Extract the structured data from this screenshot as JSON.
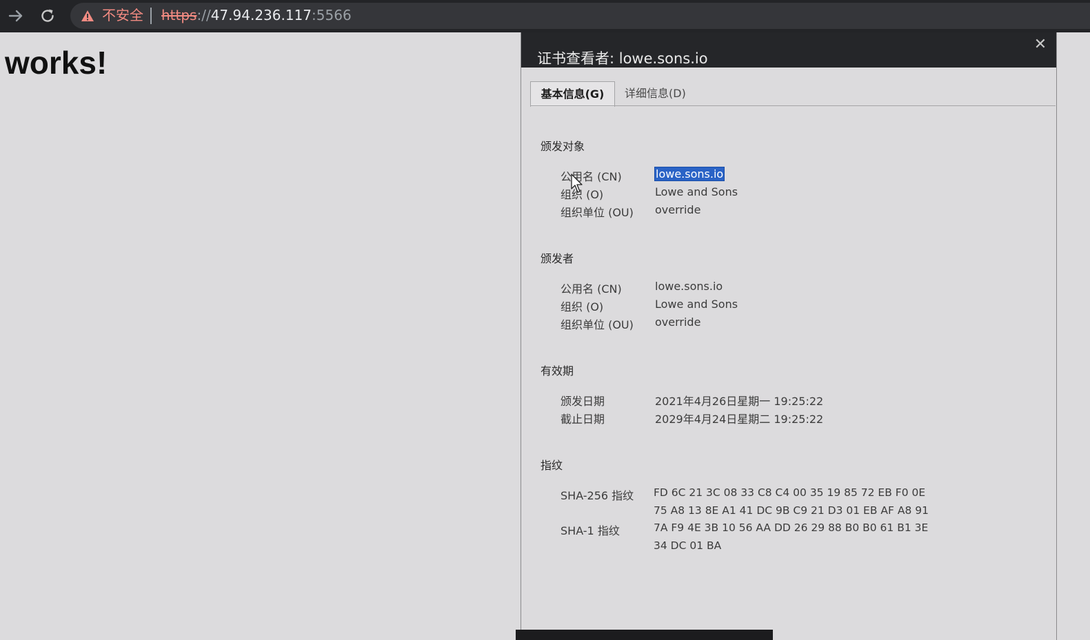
{
  "browser": {
    "security_label": "不安全",
    "url_scheme": "https",
    "url_separator": "://",
    "url_host": "47.94.236.117",
    "url_port": ":5566",
    "icons": {
      "forward": "arrow-right-icon",
      "reload": "reload-icon",
      "warning": "warning-triangle-icon"
    }
  },
  "page": {
    "heading": "works!"
  },
  "dialog": {
    "title": "证书查看者: lowe.sons.io",
    "close_symbol": "✕",
    "tabs": [
      {
        "label": "基本信息(G)",
        "active": true
      },
      {
        "label": "详细信息(D)",
        "active": false
      }
    ],
    "issued_to": {
      "title": "颁发对象",
      "rows": [
        {
          "label": "公用名 (CN)",
          "value": "lowe.sons.io",
          "selected": true
        },
        {
          "label": "组织 (O)",
          "value": "Lowe and Sons"
        },
        {
          "label": "组织单位 (OU)",
          "value": "override"
        }
      ]
    },
    "issued_by": {
      "title": "颁发者",
      "rows": [
        {
          "label": "公用名 (CN)",
          "value": "lowe.sons.io"
        },
        {
          "label": "组织 (O)",
          "value": "Lowe and Sons"
        },
        {
          "label": "组织单位 (OU)",
          "value": "override"
        }
      ]
    },
    "validity": {
      "title": "有效期",
      "rows": [
        {
          "label": "颁发日期",
          "value": "2021年4月26日星期一 19:25:22"
        },
        {
          "label": "截止日期",
          "value": "2029年4月24日星期二 19:25:22"
        }
      ]
    },
    "fingerprints": {
      "title": "指纹",
      "rows": [
        {
          "label": "SHA-256 指纹",
          "line1": "FD 6C 21 3C 08 33 C8 C4 00 35 19 85 72 EB F0 0E",
          "line2": "75 A8 13 8E A1 41 DC 9B C9 21 D3 01 EB AF A8 91"
        },
        {
          "label": "SHA-1 指纹",
          "line1": "7A F9 4E 3B 10 56 AA DD 26 29 88 B0 B0 61 B1 3E",
          "line2": "34 DC 01 BA"
        }
      ]
    }
  },
  "colors": {
    "selection": "#2a63c6",
    "insecure": "#f28b82",
    "titlebar": "#252629"
  }
}
